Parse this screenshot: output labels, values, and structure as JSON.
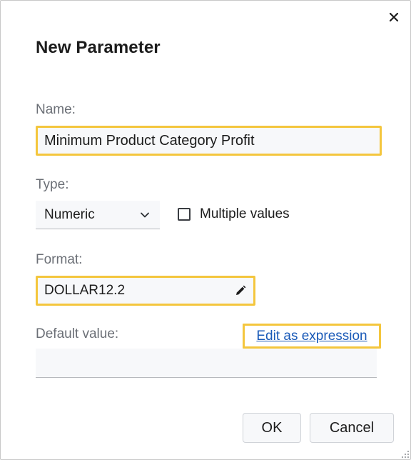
{
  "dialog": {
    "title": "New Parameter",
    "close_icon": "close-icon"
  },
  "name": {
    "label": "Name:",
    "value": "Minimum Product Category Profit"
  },
  "type": {
    "label": "Type:",
    "selected": "Numeric",
    "chevron_icon": "chevron-down-icon"
  },
  "multiple_values": {
    "label": "Multiple values",
    "checked": false
  },
  "format": {
    "label": "Format:",
    "value": "DOLLAR12.2",
    "edit_icon": "pencil-icon"
  },
  "default_value": {
    "label": "Default value:",
    "value": "",
    "link_label": "Edit as expression"
  },
  "buttons": {
    "ok": "OK",
    "cancel": "Cancel"
  },
  "colors": {
    "highlight": "#f4c63d",
    "link": "#1a5ab8",
    "label": "#6b6f76",
    "field_bg": "#f7f8fa"
  }
}
